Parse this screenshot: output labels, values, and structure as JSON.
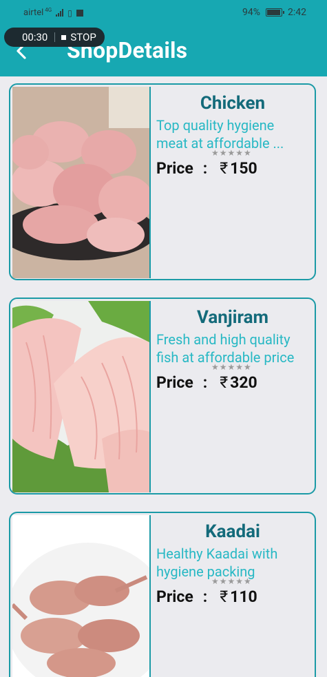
{
  "status": {
    "carrier": "airtel",
    "network": "4G",
    "battery": "94%",
    "time": "2:42"
  },
  "recorder": {
    "time": "00:30",
    "stop_label": "STOP"
  },
  "header": {
    "title": "ShopDetails",
    "back_icon": "chevron-left-icon"
  },
  "items": [
    {
      "name": "Chicken",
      "description": [
        "Top quality hygiene",
        "meat at affordable ..."
      ],
      "rating_stars": "★★★★★",
      "price_label": "Price",
      "currency": "₹",
      "price": "150"
    },
    {
      "name": "Vanjiram",
      "description": [
        "Fresh and high quality",
        "fish at affordable price"
      ],
      "rating_stars": "★★★★★",
      "price_label": "Price",
      "currency": "₹",
      "price": "320"
    },
    {
      "name": "Kaadai",
      "description": [
        "Healthy Kaadai with",
        "hygiene packing"
      ],
      "rating_stars": "★★★★★",
      "price_label": "Price",
      "currency": "₹",
      "price": "110"
    }
  ],
  "colors": {
    "accent": "#17a8b2",
    "name_text": "#136a7a",
    "desc_text": "#27b8c4"
  }
}
